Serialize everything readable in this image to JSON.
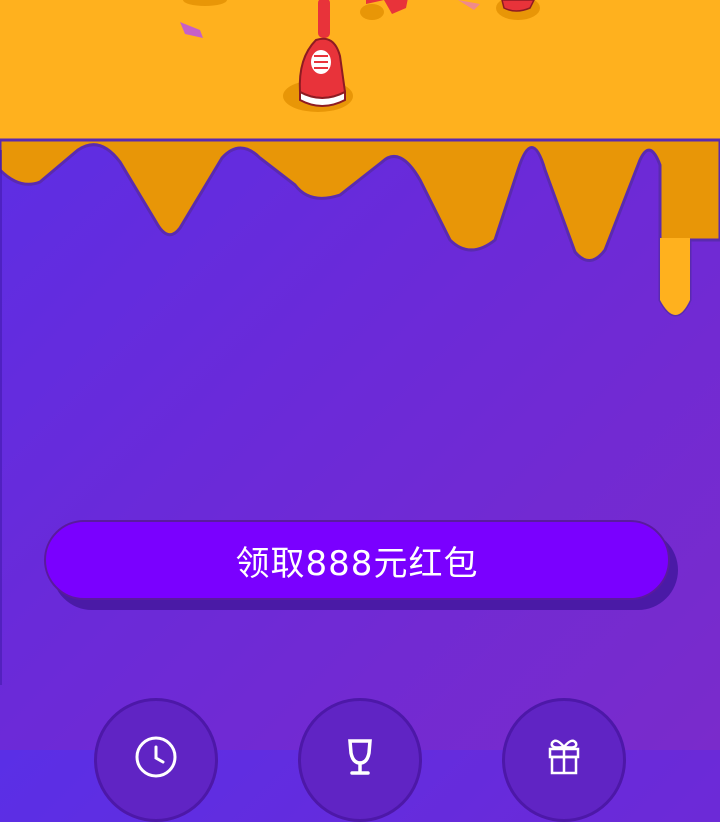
{
  "cta": {
    "label": "领取888元红包"
  },
  "bottom_nav": {
    "items": [
      {
        "icon": "clock-icon"
      },
      {
        "icon": "trophy-icon"
      },
      {
        "icon": "gift-icon"
      }
    ]
  },
  "colors": {
    "top_background": "#ffb11e",
    "drip_shadow": "#e89607",
    "purple_start": "#5a2fe6",
    "purple_end": "#7a2bcb",
    "button": "#7a00ff",
    "shoe_red": "#e8333a"
  }
}
